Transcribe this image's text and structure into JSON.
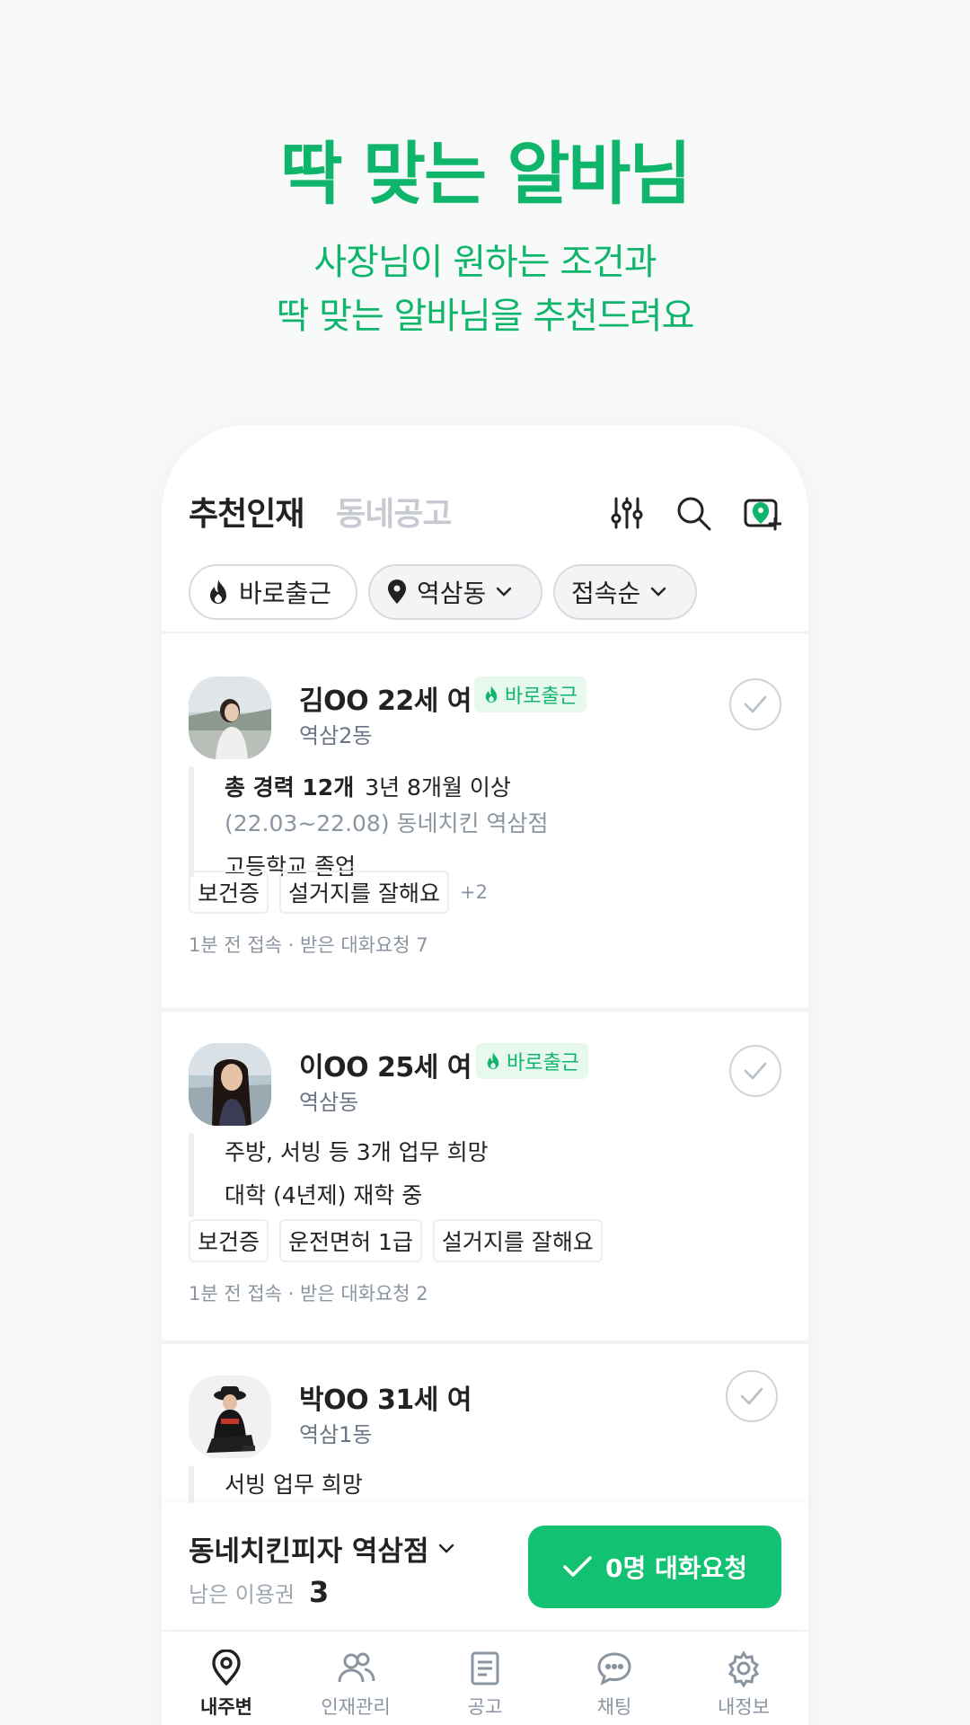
{
  "promo": {
    "title": "딱 맞는 알바님",
    "subtitle_line1": "사장님이 원하는 조건과",
    "subtitle_line2": "딱 맞는 알바님을 추천드려요"
  },
  "header": {
    "tab_active": "추천인재",
    "tab_inactive": "동네공고",
    "icons": [
      "filter-sliders-icon",
      "search-icon",
      "location-add-icon"
    ]
  },
  "filters": {
    "chip1": "바로출근",
    "chip2": "역삼동",
    "chip3": "접속순"
  },
  "candidates": [
    {
      "name": "김OO 22세 여",
      "badge": "바로출근",
      "location": "역삼2동",
      "career_bold": "총 경력 12개",
      "career_duration": "3년 8개월 이상",
      "career_detail": "(22.03~22.08) 동네치킨 역삼점",
      "education": "고등학교 졸업",
      "tags": [
        "보건증",
        "설거지를 잘해요"
      ],
      "tags_more": "+2",
      "meta": "1분 전 접속 · 받은 대화요청 7"
    },
    {
      "name": "이OO 25세 여",
      "badge": "바로출근",
      "location": "역삼동",
      "line1": "주방, 서빙 등 3개 업무 희망",
      "line2": "대학 (4년제) 재학 중",
      "tags": [
        "보건증",
        "운전면허 1급",
        "설거지를 잘해요"
      ],
      "meta": "1분 전 접속 · 받은 대화요청 2"
    },
    {
      "name": "박OO 31세 여",
      "location": "역삼1동",
      "line1": "서빙 업무 희망"
    }
  ],
  "bottom": {
    "store": "동네치킨피자 역삼점",
    "remain_label": "남은 이용권",
    "remain_value": "3",
    "cta": "0명 대화요청"
  },
  "nav": [
    "내주변",
    "인재관리",
    "공고",
    "채팅",
    "내정보"
  ],
  "colors": {
    "brand": "#10b56c",
    "cta": "#12c272"
  }
}
